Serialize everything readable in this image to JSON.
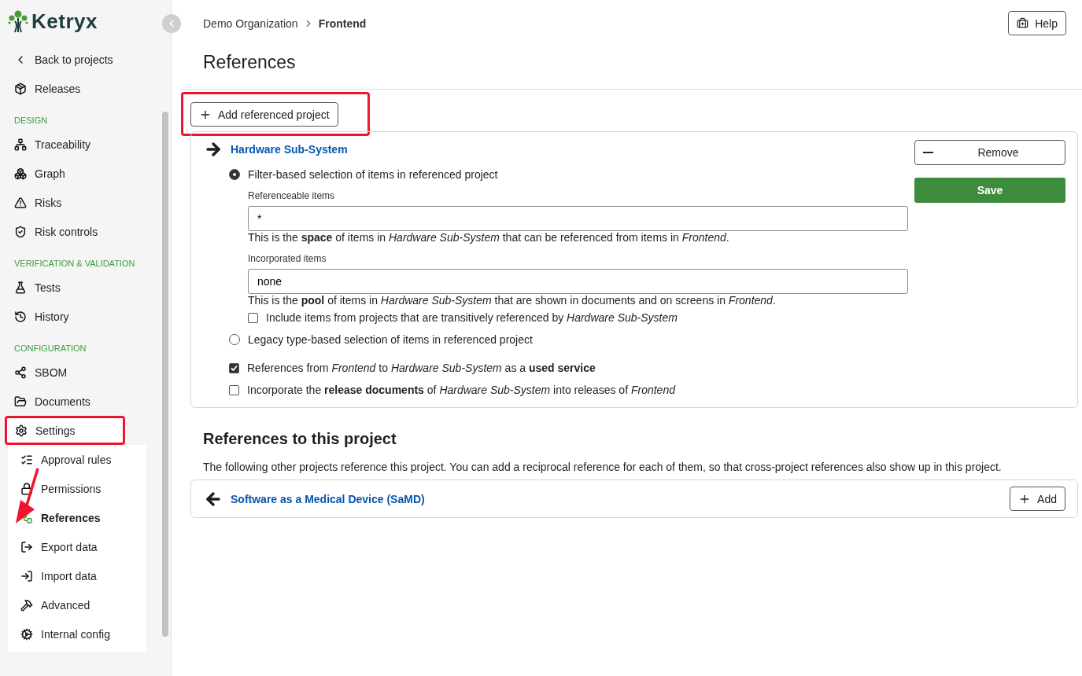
{
  "logo": {
    "text": "Ketryx"
  },
  "sidebar": {
    "back_link": "Back to projects",
    "top_items": [
      {
        "label": "Releases",
        "selected": false
      }
    ],
    "sections": [
      {
        "heading": "DESIGN",
        "items": [
          {
            "label": "Traceability",
            "selected": false
          },
          {
            "label": "Graph",
            "selected": false
          },
          {
            "label": "Risks",
            "selected": false
          },
          {
            "label": "Risk controls",
            "selected": false
          }
        ]
      },
      {
        "heading": "VERIFICATION & VALIDATION",
        "items": [
          {
            "label": "Tests",
            "selected": false
          },
          {
            "label": "History",
            "selected": false
          }
        ]
      },
      {
        "heading": "CONFIGURATION",
        "items": [
          {
            "label": "SBOM",
            "selected": false
          },
          {
            "label": "Documents",
            "selected": false
          },
          {
            "label": "Settings",
            "selected": false,
            "highlighted": true,
            "expanded": true,
            "children": [
              {
                "label": "Approval rules",
                "selected": false
              },
              {
                "label": "Permissions",
                "selected": false
              },
              {
                "label": "References",
                "selected": true
              },
              {
                "label": "Export data",
                "selected": false
              },
              {
                "label": "Import data",
                "selected": false
              },
              {
                "label": "Advanced",
                "selected": false
              },
              {
                "label": "Internal config",
                "selected": false
              }
            ]
          }
        ]
      }
    ]
  },
  "annotation": {
    "kind": "arrow"
  },
  "breadcrumb": [
    "Demo Organization",
    "Frontend"
  ],
  "help_button": "Help",
  "page_title": "References",
  "add_button": {
    "label": "Add referenced project",
    "highlighted": true
  },
  "outgoing": [
    {
      "name": "Hardware Sub-System",
      "remove_button": "Remove",
      "save_button": "Save",
      "selection_options": [
        {
          "label": "Filter-based selection of items in referenced project",
          "selected": true
        },
        {
          "label": "Legacy type-based selection of items in referenced project",
          "selected": false
        }
      ],
      "fields": [
        {
          "label": "Referenceable items",
          "value": "*",
          "help": "This is the **space** of items in *Hardware Sub-System* that can be referenced from items in *Frontend*."
        },
        {
          "label": "Incorporated items",
          "value": "none",
          "help": "This is the **pool** of items in *Hardware Sub-System* that are shown in documents and on screens in *Frontend*."
        }
      ],
      "transitive": {
        "label": "Include items from projects that are transitively referenced by *Hardware Sub-System*",
        "checked": false
      },
      "options": [
        {
          "label": "References from *Frontend* to *Hardware Sub-System* as a **used service**",
          "checked": true
        },
        {
          "label": "Incorporate the **release documents** of *Hardware Sub-System* into releases of *Frontend*",
          "checked": false
        }
      ]
    }
  ],
  "incoming": {
    "heading": "References to this project",
    "text": "The following other projects reference this project. You can add a reciprocal reference for each of them, so that cross-project references also show up in this project.",
    "projects": [
      {
        "name": "Software as a Medical Device (SaMD)",
        "button": "Add"
      }
    ]
  }
}
